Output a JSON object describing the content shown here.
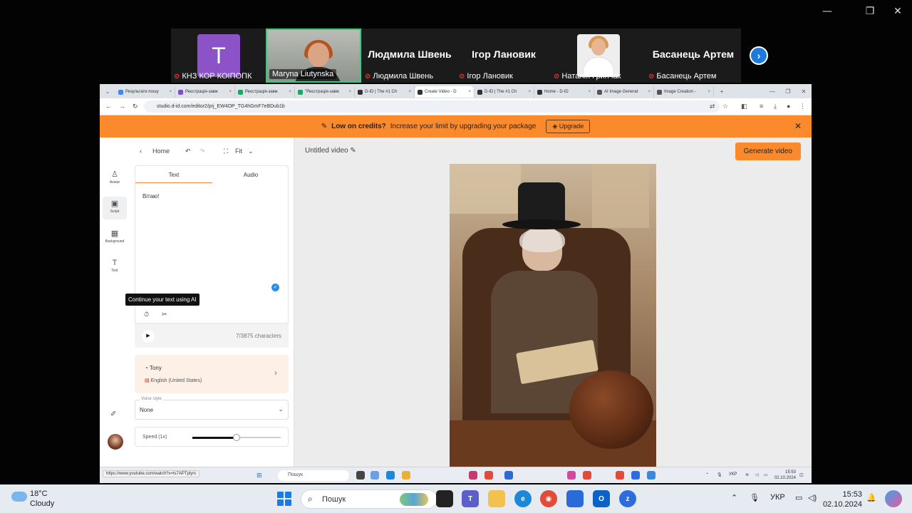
{
  "participants": [
    {
      "name": "КНЗ КОР КОІПОПК",
      "initial": "T",
      "muted": true
    },
    {
      "name": "Maryna Liutynska",
      "muted": false,
      "active": true
    },
    {
      "name": "Людмила Швень",
      "big": "Людмила Швень",
      "muted": true
    },
    {
      "name": "Ігор Лановик",
      "big": "Ігор Лановик",
      "muted": true
    },
    {
      "name": "Наталія Гринчак",
      "muted": true
    },
    {
      "name": "Басанець Артем",
      "big": "Басанець Артем",
      "muted": true
    }
  ],
  "browser": {
    "tabs": [
      {
        "label": "Результати пошу",
        "color": "#4285f4"
      },
      {
        "label": "Реєстрація-завж",
        "color": "#7b4fc9"
      },
      {
        "label": "Реєстрація-завж",
        "color": "#1fa463"
      },
      {
        "label": "\"Реєстрація-завж",
        "color": "#1fa463"
      },
      {
        "label": "D-ID | The #1 Ch",
        "color": "#333"
      },
      {
        "label": "Create Video - D",
        "color": "#333",
        "active": true
      },
      {
        "label": "D-ID | The #1 Ch",
        "color": "#333"
      },
      {
        "label": "Home - D-ID",
        "color": "#333"
      },
      {
        "label": "AI Image Generat",
        "color": "#555"
      },
      {
        "label": "Image Creation -",
        "color": "#555"
      }
    ],
    "url": "studio.d-id.com/editor2/prj_EW4OP_TG4hGmF7eBDub1b"
  },
  "banner": {
    "title": "Low on credits?",
    "message": "Increase your limit by upgrading your package",
    "button": "Upgrade"
  },
  "rail": [
    {
      "label": "Avatar",
      "icon": "person-icon"
    },
    {
      "label": "Script",
      "icon": "script-icon",
      "active": true
    },
    {
      "label": "Background",
      "icon": "background-icon"
    },
    {
      "label": "Text",
      "icon": "text-icon"
    }
  ],
  "editor": {
    "home": "Home",
    "fit": "Fit",
    "tabs": [
      "Text",
      "Audio"
    ],
    "script_text": "Вітаю!",
    "tooltip": "Continue your text using AI",
    "char_count": "7/3875 characters",
    "voice_name": "Tony",
    "voice_lang": "English (United States)",
    "voice_style_label": "Voice style",
    "voice_style_value": "None",
    "speed_label": "Speed (1x)",
    "speed_value": 0.5
  },
  "canvas": {
    "title": "Untitled video",
    "generate": "Generate video"
  },
  "inner_taskbar": {
    "status_url": "https://www.youtube.com/watch?v=ts7APTplyrs",
    "search": "Пошук",
    "lang": "УКР",
    "time": "15:53",
    "date": "02.10.2024"
  },
  "taskbar": {
    "temp": "18°C",
    "weather": "Cloudy",
    "search": "Пошук",
    "lang": "УКР",
    "time": "15:53",
    "date": "02.10.2024"
  }
}
